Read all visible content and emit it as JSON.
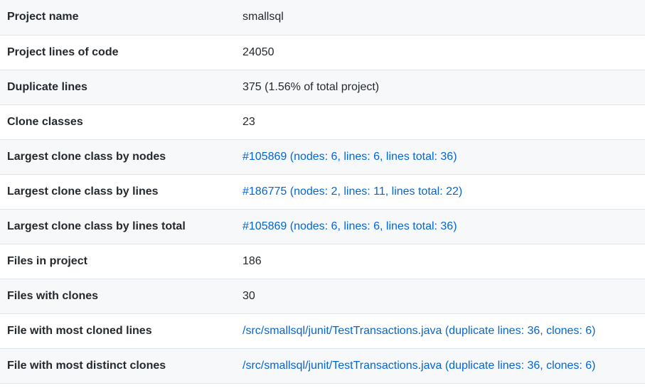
{
  "stats": {
    "rows": [
      {
        "label": "Project name",
        "value": "smallsql",
        "link": false
      },
      {
        "label": "Project lines of code",
        "value": "24050",
        "link": false
      },
      {
        "label": "Duplicate lines",
        "value": "375 (1.56% of total project)",
        "link": false
      },
      {
        "label": "Clone classes",
        "value": "23",
        "link": false
      },
      {
        "label": "Largest clone class by nodes",
        "value": "#105869 (nodes: 6, lines: 6, lines total: 36)",
        "link": true
      },
      {
        "label": "Largest clone class by lines",
        "value": "#186775 (nodes: 2, lines: 11, lines total: 22)",
        "link": true
      },
      {
        "label": "Largest clone class by lines total",
        "value": "#105869 (nodes: 6, lines: 6, lines total: 36)",
        "link": true
      },
      {
        "label": "Files in project",
        "value": "186",
        "link": false
      },
      {
        "label": "Files with clones",
        "value": "30",
        "link": false
      },
      {
        "label": "File with most cloned lines",
        "value": "/src/smallsql/junit/TestTransactions.java (duplicate lines: 36, clones: 6)",
        "link": true
      },
      {
        "label": "File with most distinct clones",
        "value": "/src/smallsql/junit/TestTransactions.java (duplicate lines: 36, clones: 6)",
        "link": true
      }
    ]
  },
  "colors": {
    "link": "#0366d6",
    "text": "#24292e",
    "row_alt": "#f6f8fa",
    "border": "#e1e4e8"
  }
}
